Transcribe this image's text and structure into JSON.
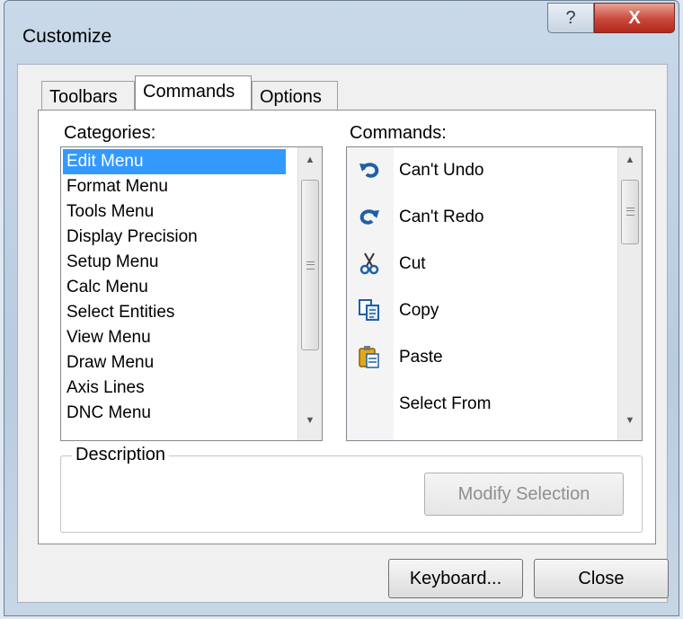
{
  "window": {
    "title": "Customize",
    "help_label": "?",
    "close_label": "X"
  },
  "tabs": [
    {
      "label": "Toolbars",
      "active": false
    },
    {
      "label": "Commands",
      "active": true
    },
    {
      "label": "Options",
      "active": false
    }
  ],
  "categories": {
    "label": "Categories:",
    "items": [
      "Edit Menu",
      "Format Menu",
      "Tools Menu",
      "Display Precision",
      "Setup Menu",
      "Calc Menu",
      "Select Entities",
      "View Menu",
      "Draw Menu",
      "Axis Lines",
      "DNC Menu"
    ],
    "selected": "Edit Menu"
  },
  "commands": {
    "label": "Commands:",
    "items": [
      {
        "label": "Can't Undo",
        "icon": "undo-icon"
      },
      {
        "label": "Can't Redo",
        "icon": "redo-icon"
      },
      {
        "label": "Cut",
        "icon": "scissors-icon"
      },
      {
        "label": "Copy",
        "icon": "copy-icon"
      },
      {
        "label": "Paste",
        "icon": "paste-icon"
      },
      {
        "label": "Select From",
        "icon": ""
      }
    ]
  },
  "description": {
    "legend": "Description",
    "modify_label": "Modify Selection"
  },
  "footer": {
    "keyboard_label": "Keyboard...",
    "close_label": "Close"
  },
  "colors": {
    "selection": "#3399ff",
    "title_close": "#c9483a",
    "icon_blue": "#1f5fa8"
  }
}
